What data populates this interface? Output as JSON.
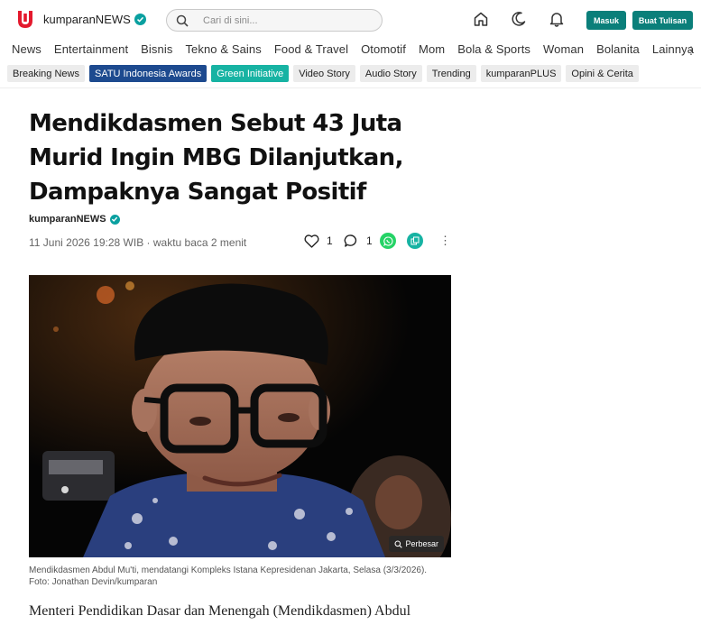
{
  "header": {
    "brand": "kumparanNEWS",
    "search_placeholder": "Cari di sini...",
    "login_label": "Masuk",
    "write_label": "Buat Tulisan"
  },
  "nav": {
    "items": [
      "News",
      "Entertainment",
      "Bisnis",
      "Tekno & Sains",
      "Food & Travel",
      "Otomotif",
      "Mom",
      "Bola & Sports",
      "Woman",
      "Bolanita",
      "Lainnya"
    ]
  },
  "tags": [
    {
      "label": "Breaking News",
      "style": "default"
    },
    {
      "label": "SATU Indonesia Awards",
      "style": "blue"
    },
    {
      "label": "Green Initiative",
      "style": "teal"
    },
    {
      "label": "Video Story",
      "style": "default"
    },
    {
      "label": "Audio Story",
      "style": "default"
    },
    {
      "label": "Trending",
      "style": "default"
    },
    {
      "label": "kumparanPLUS",
      "style": "default"
    },
    {
      "label": "Opini & Cerita",
      "style": "default"
    }
  ],
  "article": {
    "title": "Mendikdasmen Sebut 43 Juta Murid Ingin MBG Dilanjutkan, Dampaknya Sangat Positif",
    "author": "kumparanNEWS",
    "meta": "11 Juni 2026 19:28 WIB · waktu baca 2 menit",
    "likes": "1",
    "comments": "1",
    "enlarge_label": "Perbesar",
    "caption_line1": "Mendikdasmen Abdul Mu'ti, mendatangi Kompleks Istana Kepresidenan Jakarta, Selasa (3/3/2026).",
    "caption_line2": "Foto: Jonathan Devin/kumparan",
    "body_start": "Menteri Pendidikan Dasar dan Menengah (Mendikdasmen) Abdul"
  },
  "colors": {
    "brand_red": "#e4192d",
    "teal_button": "#0b7f7a",
    "tag_blue": "#1d4a8f",
    "tag_teal": "#17b3a3",
    "verified": "#0aa0a0",
    "whatsapp": "#25d366"
  },
  "icons": [
    "logo-icon",
    "verified-icon",
    "search-icon",
    "home-icon",
    "moon-icon",
    "bell-icon",
    "heart-icon",
    "comment-icon",
    "whatsapp-icon",
    "copy-link-icon",
    "more-icon",
    "zoom-icon"
  ]
}
